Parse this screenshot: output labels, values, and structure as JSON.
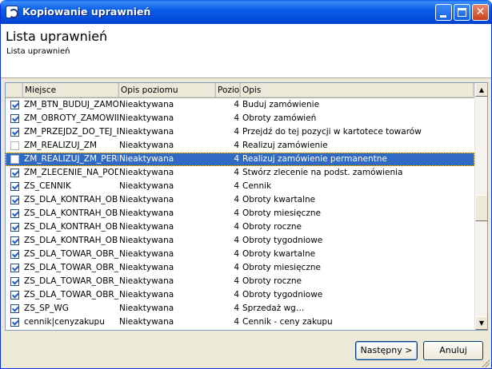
{
  "window": {
    "title": "Kopiowanie uprawnień",
    "icons": {
      "app": "app-logo-icon",
      "minimize": "minimize-icon",
      "maximize": "maximize-icon",
      "close": "close-icon"
    },
    "close_glyph": "✕"
  },
  "header": {
    "title": "Lista uprawnień",
    "subtitle": "Lista uprawnień"
  },
  "grid": {
    "columns": [
      {
        "key": "miejsce",
        "label": "Miejsce"
      },
      {
        "key": "opis_poziomu",
        "label": "Opis poziomu"
      },
      {
        "key": "poziom",
        "label": "Poziom"
      },
      {
        "key": "opis",
        "label": "Opis"
      }
    ],
    "sort_glyph": "△",
    "rows": [
      {
        "checked": true,
        "miejsce": "ZM_BTN_BUDUJ_ZAMOWIENIE",
        "opis_poziomu": "Nieaktywana",
        "poziom": "4",
        "opis": "Buduj zamówienie",
        "selected": false
      },
      {
        "checked": true,
        "miejsce": "ZM_OBROTY_ZAMOWIENIA",
        "opis_poziomu": "Nieaktywana",
        "poziom": "4",
        "opis": "Obroty zamówień",
        "selected": false
      },
      {
        "checked": true,
        "miejsce": "ZM_PRZEJDZ_DO_TEJ_POZYCJI",
        "opis_poziomu": "Nieaktywana",
        "poziom": "4",
        "opis": "Przejdź do tej pozycji w kartotece towarów",
        "selected": false
      },
      {
        "checked": false,
        "miejsce": "ZM_REALIZUJ_ZM",
        "opis_poziomu": "Nieaktywana",
        "poziom": "4",
        "opis": "Realizuj zamówienie",
        "selected": false
      },
      {
        "checked": false,
        "miejsce": "ZM_REALIZUJ_ZM_PERM",
        "opis_poziomu": "Nieaktywana",
        "poziom": "4",
        "opis": "Realizuj zamówienie permanentne",
        "selected": true
      },
      {
        "checked": true,
        "miejsce": "ZM_ZLECENIE_NA_PODST",
        "opis_poziomu": "Nieaktywana",
        "poziom": "4",
        "opis": "Stwórz zlecenie na podst. zamówienia",
        "selected": false
      },
      {
        "checked": true,
        "miejsce": "ZS_CENNIK",
        "opis_poziomu": "Nieaktywana",
        "poziom": "4",
        "opis": "Cennik",
        "selected": false
      },
      {
        "checked": true,
        "miejsce": "ZS_DLA_KONTRAH_OBROTY",
        "opis_poziomu": "Nieaktywana",
        "poziom": "4",
        "opis": "Obroty kwartalne",
        "selected": false
      },
      {
        "checked": true,
        "miejsce": "ZS_DLA_KONTRAH_OBROTY",
        "opis_poziomu": "Nieaktywana",
        "poziom": "4",
        "opis": "Obroty miesięczne",
        "selected": false
      },
      {
        "checked": true,
        "miejsce": "ZS_DLA_KONTRAH_OBROTY",
        "opis_poziomu": "Nieaktywana",
        "poziom": "4",
        "opis": "Obroty roczne",
        "selected": false
      },
      {
        "checked": true,
        "miejsce": "ZS_DLA_KONTRAH_OBROTY",
        "opis_poziomu": "Nieaktywana",
        "poziom": "4",
        "opis": "Obroty tygodniowe",
        "selected": false
      },
      {
        "checked": true,
        "miejsce": "ZS_DLA_TOWAR_OBR_KW",
        "opis_poziomu": "Nieaktywana",
        "poziom": "4",
        "opis": "Obroty kwartalne",
        "selected": false
      },
      {
        "checked": true,
        "miejsce": "ZS_DLA_TOWAR_OBR_MIES",
        "opis_poziomu": "Nieaktywana",
        "poziom": "4",
        "opis": "Obroty miesięczne",
        "selected": false
      },
      {
        "checked": true,
        "miejsce": "ZS_DLA_TOWAR_OBR_ROCZ",
        "opis_poziomu": "Nieaktywana",
        "poziom": "4",
        "opis": "Obroty roczne",
        "selected": false
      },
      {
        "checked": true,
        "miejsce": "ZS_DLA_TOWAR_OBR_TYG",
        "opis_poziomu": "Nieaktywana",
        "poziom": "4",
        "opis": "Obroty tygodniowe",
        "selected": false
      },
      {
        "checked": true,
        "miejsce": "ZS_SP_WG",
        "opis_poziomu": "Nieaktywana",
        "poziom": "4",
        "opis": "Sprzedaż wg…",
        "selected": false
      },
      {
        "checked": true,
        "miejsce": "cennik|cenyzakupu",
        "opis_poziomu": "Nieaktywana",
        "poziom": "4",
        "opis": "Cennik - ceny zakupu",
        "selected": false
      }
    ]
  },
  "scrollbar": {
    "up_glyph": "▲",
    "down_glyph": "▼"
  },
  "buttons": {
    "next": "Następny >",
    "cancel": "Anuluj"
  }
}
